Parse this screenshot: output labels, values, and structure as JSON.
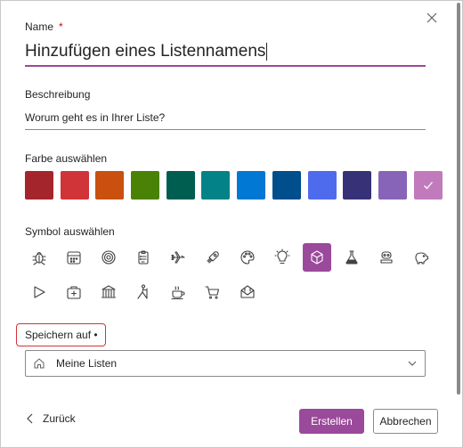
{
  "dialog": {
    "name_label": "Name",
    "required_marker": "*",
    "name_value": "Hinzufügen eines Listennamens",
    "description_label": "Beschreibung",
    "description_placeholder": "Worum geht es in Ihrer Liste?",
    "color_label": "Farbe auswählen",
    "colors": [
      {
        "name": "dark-red",
        "hex": "#a4262c"
      },
      {
        "name": "red",
        "hex": "#d13438"
      },
      {
        "name": "orange",
        "hex": "#ca5010"
      },
      {
        "name": "green",
        "hex": "#498205"
      },
      {
        "name": "dark-teal",
        "hex": "#005e50"
      },
      {
        "name": "teal",
        "hex": "#038387"
      },
      {
        "name": "blue",
        "hex": "#0078d4"
      },
      {
        "name": "dark-blue",
        "hex": "#004e8c"
      },
      {
        "name": "periwinkle",
        "hex": "#4f6bed"
      },
      {
        "name": "indigo",
        "hex": "#373277"
      },
      {
        "name": "purple",
        "hex": "#8764b8"
      },
      {
        "name": "orchid",
        "hex": "#c17bbd",
        "selected": true
      }
    ],
    "icon_label": "Symbol auswählen",
    "icons_row1": [
      "bug-icon",
      "calendar-icon",
      "target-icon",
      "clipboard-icon",
      "airplane-icon",
      "rocket-icon",
      "palette-icon",
      "lightbulb-icon",
      "cube-icon",
      "flask-icon",
      "robot-icon",
      "piggy-bank-icon"
    ],
    "icons_row2": [
      "play-icon",
      "medical-kit-icon",
      "bank-icon",
      "hiking-icon",
      "coffee-icon",
      "cart-icon",
      "mail-icon"
    ],
    "selected_icon": "cube-icon",
    "save_to_label": "Speichern auf •",
    "save_to_value": "Meine Listen",
    "back_label": "Zurück",
    "create_label": "Erstellen",
    "cancel_label": "Abbrechen",
    "accent_color": "#9b4a9b"
  }
}
